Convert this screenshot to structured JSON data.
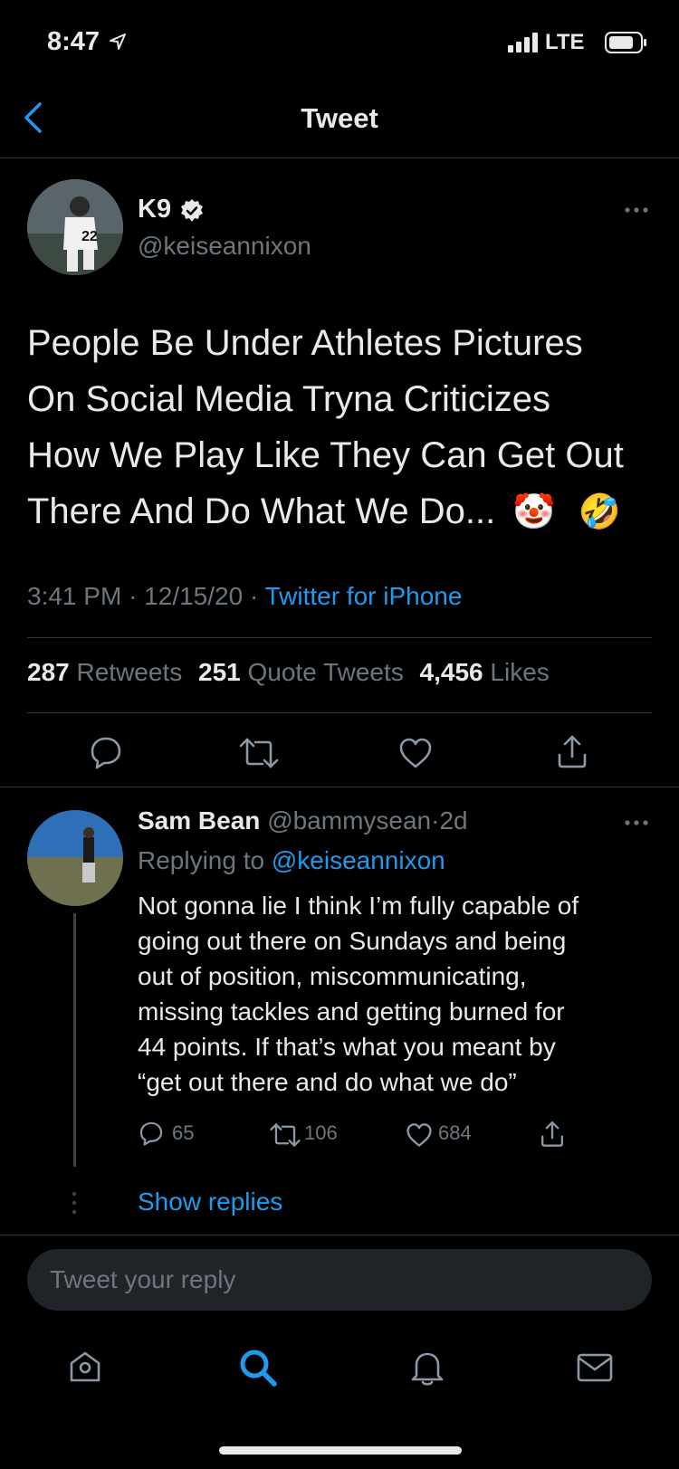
{
  "status_bar": {
    "time": "8:47",
    "network": "LTE"
  },
  "header": {
    "title": "Tweet"
  },
  "tweet": {
    "display_name": "K9",
    "handle": "@keiseannixon",
    "text_lines": [
      "People Be Under Athletes Pictures",
      "On Social Media Tryna Criticizes",
      "How We Play Like They Can Get Out",
      "There And Do What We Do..."
    ],
    "emoji_1": "🤡",
    "emoji_2": "🤣",
    "time": "3:41 PM",
    "date": "12/15/20",
    "source": "Twitter for iPhone",
    "sep": "·",
    "retweets_count": "287",
    "retweets_label": "Retweets",
    "quotes_count": "251",
    "quotes_label": "Quote Tweets",
    "likes_count": "4,456",
    "likes_label": "Likes"
  },
  "reply": {
    "display_name": "Sam Bean",
    "handle": "@bammysean",
    "sep": "·",
    "age": "2d",
    "replying_prefix": "Replying to",
    "replying_to": "@keiseannixon",
    "text_lines": [
      "Not gonna lie I think I’m fully capable of",
      "going out there on Sundays and being",
      "out of position, miscommunicating,",
      "missing tackles and getting burned for",
      "44 points. If that’s what you meant by",
      "“get out there and do what we do”"
    ],
    "replies_count": "65",
    "retweets_count": "106",
    "likes_count": "684",
    "show_replies": "Show replies"
  },
  "composer": {
    "placeholder": "Tweet your reply"
  },
  "colors": {
    "accent": "#1d9bf0",
    "background": "#000000",
    "divider": "#2f3336",
    "muted": "#6e767d"
  }
}
